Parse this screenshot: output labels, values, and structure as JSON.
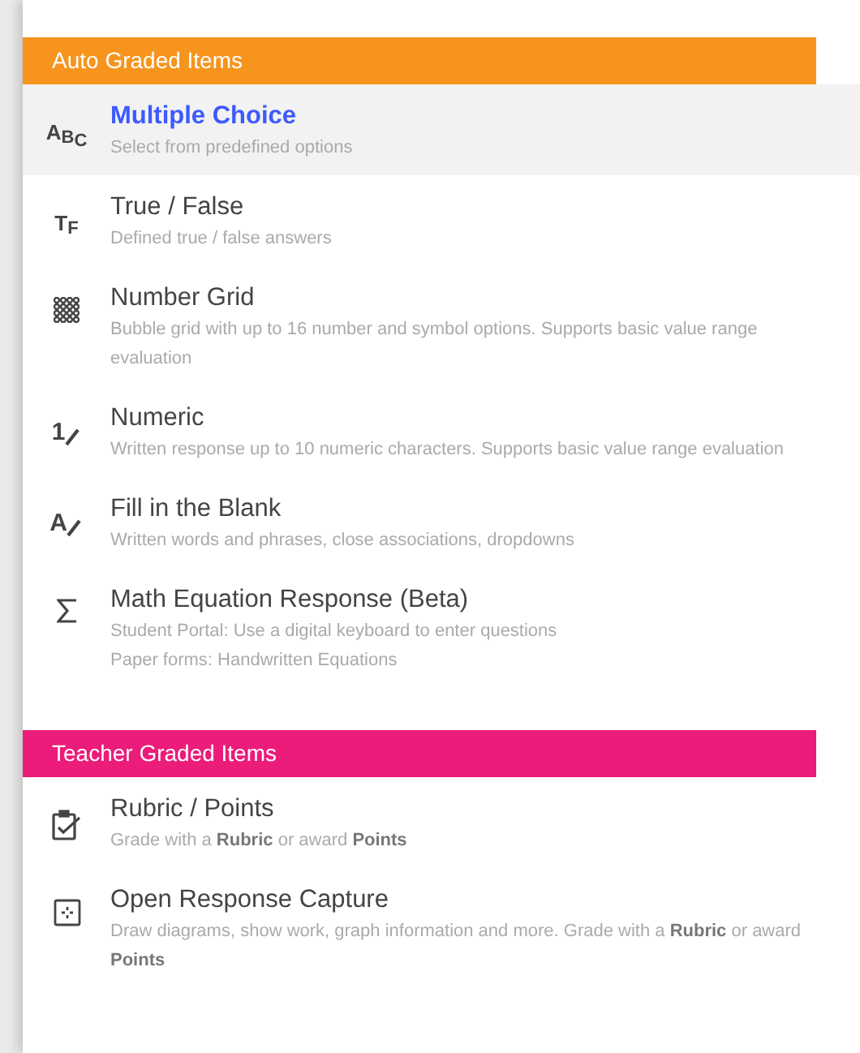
{
  "sections": [
    {
      "title": "Auto Graded Items",
      "color": "#f7941d",
      "items": [
        {
          "title": "Multiple Choice",
          "selected": true,
          "icon": {
            "kind": "letters",
            "text": "ABC"
          },
          "lines": [
            "Select from predefined options"
          ]
        },
        {
          "title": "True / False",
          "selected": false,
          "icon": {
            "kind": "letters",
            "text": "TF"
          },
          "lines": [
            "Defined true / false answers"
          ]
        },
        {
          "title": "Number Grid",
          "selected": false,
          "icon": {
            "kind": "grid"
          },
          "lines": [
            "Bubble grid with up to 16 number and symbol options. Supports basic value range evaluation"
          ]
        },
        {
          "title": "Numeric",
          "selected": false,
          "icon": {
            "kind": "pencil",
            "text": "1"
          },
          "lines": [
            "Written response up to 10 numeric characters. Supports basic value range evaluation"
          ]
        },
        {
          "title": "Fill in the Blank",
          "selected": false,
          "icon": {
            "kind": "pencil",
            "text": "A"
          },
          "lines": [
            "Written words and phrases, close associations, dropdowns"
          ]
        },
        {
          "title": "Math Equation Response (Beta)",
          "selected": false,
          "icon": {
            "kind": "sigma"
          },
          "lines": [
            "Student Portal: Use a digital keyboard to enter questions",
            "Paper forms: Handwritten Equations"
          ]
        }
      ]
    },
    {
      "title": "Teacher Graded Items",
      "color": "#ec1c7a",
      "items": [
        {
          "title": "Rubric / Points",
          "selected": false,
          "icon": {
            "kind": "clipboard"
          },
          "lines": [
            "Grade with a **Rubric** or award **Points**"
          ]
        },
        {
          "title": "Open Response Capture",
          "selected": false,
          "icon": {
            "kind": "frame"
          },
          "lines": [
            "Draw diagrams, show work, graph information and more. Grade with a **Rubric** or award **Points**"
          ]
        }
      ]
    }
  ]
}
